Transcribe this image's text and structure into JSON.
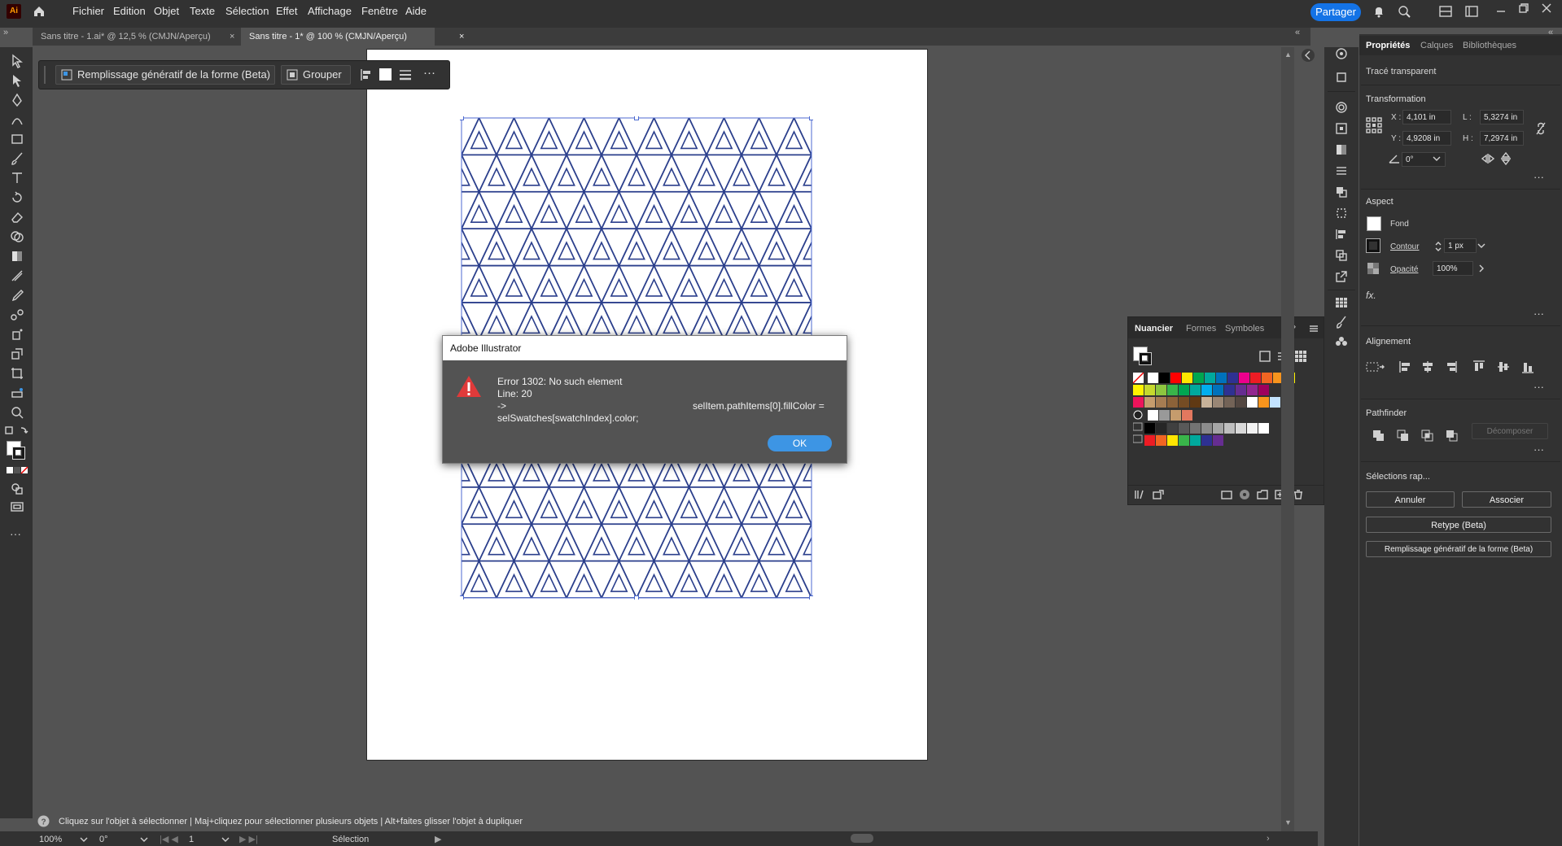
{
  "app": {
    "logo": "Ai"
  },
  "menu": [
    "Fichier",
    "Edition",
    "Objet",
    "Texte",
    "Sélection",
    "Effet",
    "Affichage",
    "Fenêtre",
    "Aide"
  ],
  "header": {
    "share": "Partager"
  },
  "tabs": [
    {
      "label": "Sans titre - 1.ai* @ 12,5 % (CMJN/Aperçu)",
      "close": "×"
    },
    {
      "label": "Sans titre - 1* @ 100 % (CMJN/Aperçu)",
      "close": "×"
    }
  ],
  "contextbar": {
    "generative_fill": "Remplissage génératif de la forme (Beta)",
    "group": "Grouper",
    "more": "···"
  },
  "pattern": {
    "stroke_color": "#2b3f8c"
  },
  "dialog": {
    "title": "Adobe Illustrator",
    "line1": "Error 1302: No such element",
    "line2": "Line: 20",
    "line3": "->",
    "line3b": "selItem.pathItems[0].fillColor =",
    "line4": "selSwatches[swatchIndex].color;",
    "ok": "OK"
  },
  "swatches_panel": {
    "tabs": [
      "Nuancier",
      "Formes",
      "Symboles"
    ],
    "rows": [
      [
        "#ffffff",
        "#000000",
        "#ff0000",
        "#ffe600",
        "#00a650",
        "#00a99d",
        "#0072bc",
        "#2e3192",
        "#ec008c",
        "#ed1c24",
        "#f26522",
        "#f7941d",
        "#fff200"
      ],
      [
        "#fff200",
        "#c6d92d",
        "#8dc63f",
        "#39b54a",
        "#00a651",
        "#00a99d",
        "#00aeef",
        "#0072bc",
        "#2e3192",
        "#662d91",
        "#92278f",
        "#9e005d"
      ],
      [
        "#ed145b",
        "#c69c6d",
        "#a67c52",
        "#8c6239",
        "#754c24",
        "#603913",
        "#c7b299",
        "#998675",
        "#736357",
        "#534741",
        "#ffffff",
        "#f7941d",
        "#c3e3ff"
      ],
      [
        "#ffffff",
        "#999999",
        "#c69c6d",
        "#e3785f"
      ],
      [
        "#000000",
        "#262626",
        "#404040",
        "#595959",
        "#737373",
        "#8c8c8c",
        "#a6a6a6",
        "#bfbfbf",
        "#d9d9d9",
        "#f2f2f2",
        "#ffffff"
      ],
      [
        "#ed1c24",
        "#f26522",
        "#ffe600",
        "#39b54a",
        "#00a99d",
        "#2e3192",
        "#662d91"
      ]
    ]
  },
  "properties": {
    "tabs": [
      "Propriétés",
      "Calques",
      "Bibliothèques"
    ],
    "object_type": "Tracé transparent",
    "transform": {
      "title": "Transformation",
      "x_label": "X :",
      "x": "4,101 in",
      "y_label": "Y :",
      "y": "4,9208 in",
      "l_label": "L :",
      "l": "5,3274 in",
      "h_label": "H :",
      "h": "7,2974 in",
      "angle": "0°"
    },
    "aspect": {
      "title": "Aspect",
      "fill": "Fond",
      "stroke": "Contour",
      "stroke_width": "1 px",
      "opacity_label": "Opacité",
      "opacity": "100%",
      "fx": "fx."
    },
    "alignment": {
      "title": "Alignement"
    },
    "pathfinder": {
      "title": "Pathfinder",
      "decompose": "Décomposer"
    },
    "quick": {
      "title": "Sélections rap...",
      "cancel": "Annuler",
      "associate": "Associer",
      "retype": "Retype (Beta)",
      "genfill": "Remplissage génératif de la forme (Beta)"
    }
  },
  "status": {
    "hint": "Cliquez sur l'objet à sélectionner  |  Maj+cliquez pour sélectionner plusieurs objets  |  Alt+faites glisser l'objet à dupliquer"
  },
  "bottom": {
    "zoom": "100%",
    "rotation": "0°",
    "page": "1",
    "tool": "Sélection"
  }
}
